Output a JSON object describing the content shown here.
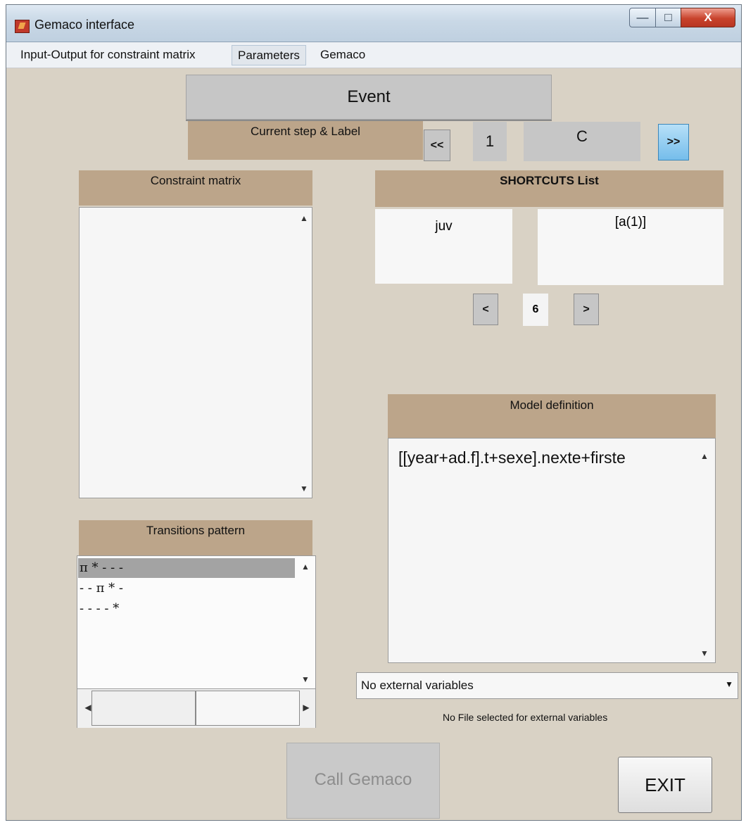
{
  "window": {
    "title": "Gemaco interface",
    "controls": {
      "minimize": "—",
      "maximize": "□",
      "close": "X"
    }
  },
  "menu": [
    "Input-Output for constraint matrix",
    "Parameters",
    "Gemaco"
  ],
  "event_button": "Event",
  "step": {
    "label": "Current step & Label",
    "prev": "<<",
    "number": "1",
    "letter": "C",
    "next": ">>"
  },
  "constraint_matrix": {
    "header": "Constraint matrix",
    "scroll_up": "▲",
    "scroll_down": "▼"
  },
  "shortcuts": {
    "header": "SHORTCUTS List",
    "name": "juv",
    "value": "[a(1)]",
    "prev": "<",
    "index": "6",
    "next": ">"
  },
  "transitions": {
    "header": "Transitions pattern",
    "rows": [
      "π * - - -",
      "- - π * -",
      "- - - - *"
    ],
    "selected_index": 0,
    "scroll_up": "▲",
    "scroll_down": "▼",
    "scroll_left": "◀",
    "scroll_right": "▶"
  },
  "model": {
    "header": "Model definition",
    "text": "[[year+ad.f].t+sexe].nexte+firste",
    "scroll_up": "▲",
    "scroll_down": "▼"
  },
  "external": {
    "selected": "No external variables",
    "arrow": "▼",
    "file_status": "No File selected for external variables"
  },
  "call_gemaco": "Call Gemaco",
  "exit": "EXIT",
  "icons": {
    "app": "matlab-logo-icon",
    "menu_scroll": "scroll-arrow-icon"
  },
  "colors": {
    "background": "#d9d2c5",
    "header_tan": "#bca58a",
    "button_gray": "#c6c6c6",
    "active_blue": "#8ecbf3"
  }
}
